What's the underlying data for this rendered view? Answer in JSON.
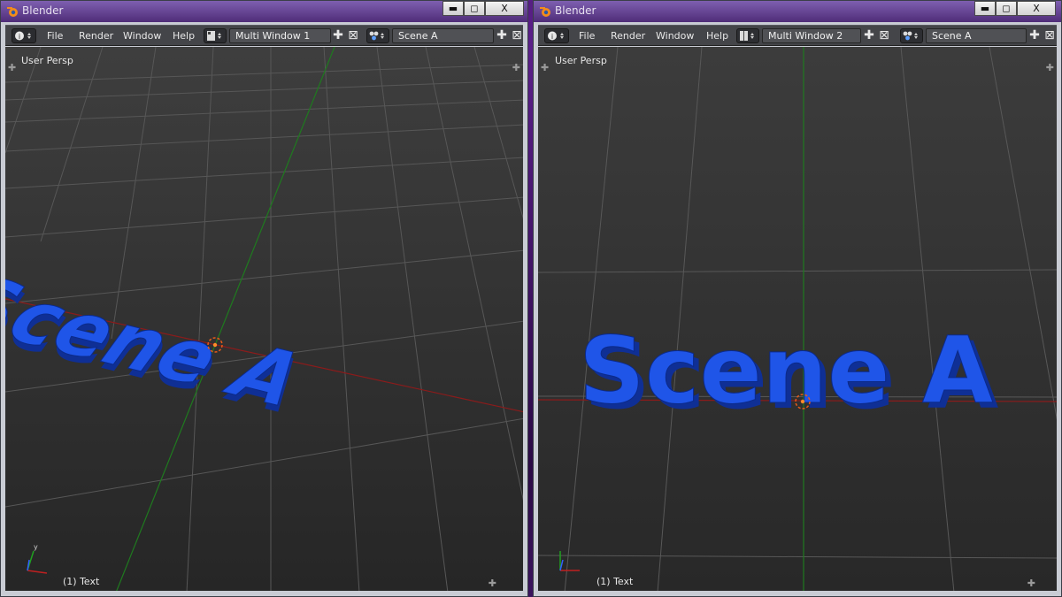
{
  "windows": [
    {
      "title": "Blender",
      "menu": [
        "File",
        "Render",
        "Window",
        "Help"
      ],
      "screen_name": "Multi Window 1",
      "scene_name": "Scene A",
      "view_label": "User Persp",
      "object_label": "(1) Text",
      "text_object": "Scene A",
      "controls": {
        "minimize": "▬",
        "maximize": "◻",
        "close": "X"
      }
    },
    {
      "title": "Blender",
      "menu": [
        "File",
        "Render",
        "Window",
        "Help"
      ],
      "screen_name": "Multi Window 2",
      "scene_name": "Scene A",
      "view_label": "User Persp",
      "object_label": "(1) Text",
      "text_object": "Scene A",
      "controls": {
        "minimize": "▬",
        "maximize": "◻",
        "close": "X"
      }
    }
  ],
  "icons": {
    "info": "info-icon",
    "screen": "screen-layout-icon",
    "scene": "scene-icon",
    "add": "add-icon",
    "remove": "remove-icon",
    "axes": "axis-gizmo-icon"
  },
  "colors": {
    "text_blue": "#1747d6",
    "grid_line": "#5a5a5a",
    "x_axis": "#8b1b1b",
    "y_axis": "#1f7a1f",
    "viewport_bg": "#3a3a3a",
    "header_bg": "#444549"
  }
}
